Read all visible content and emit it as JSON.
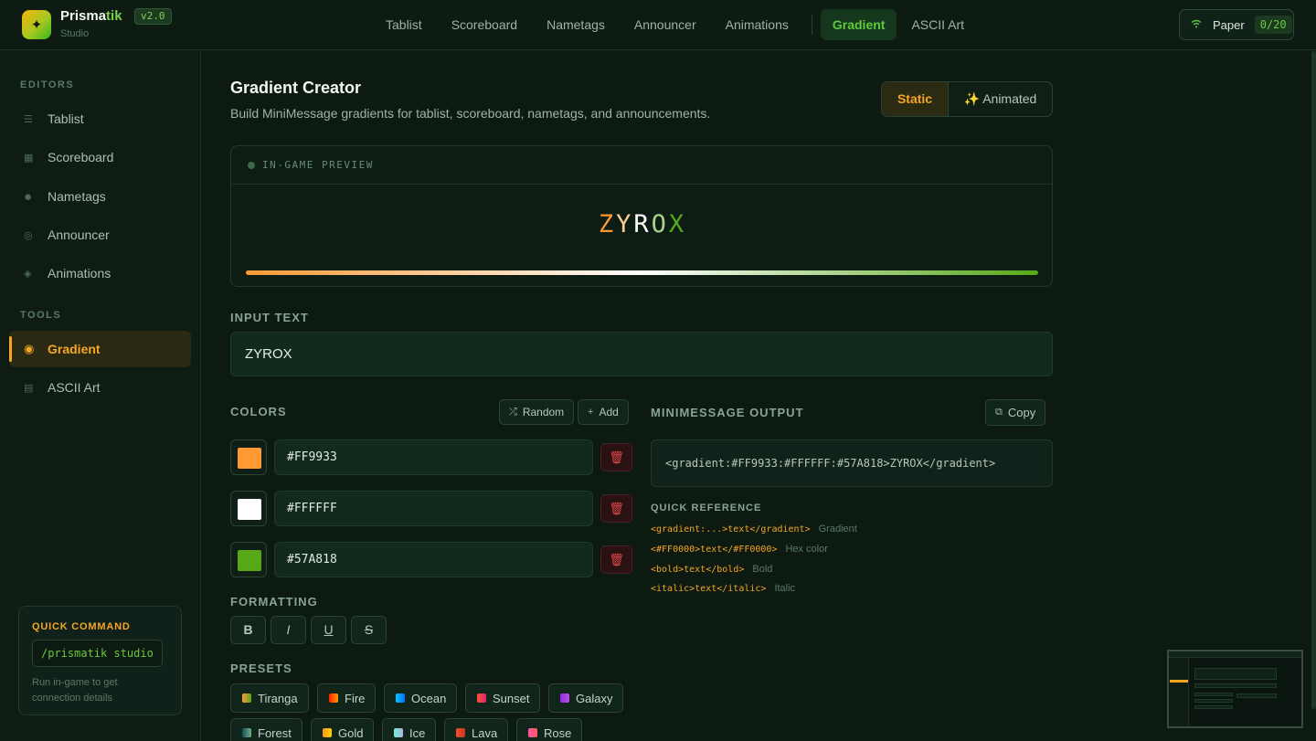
{
  "brand": {
    "name_a": "Prisma",
    "name_b": "tik",
    "version": "v2.0",
    "subtitle": "Studio",
    "logo_icon": "sparkle-icon"
  },
  "nav": {
    "items": [
      "Tablist",
      "Scoreboard",
      "Nametags",
      "Announcer",
      "Animations",
      "Gradient",
      "ASCII Art"
    ],
    "active": "Gradient"
  },
  "server": {
    "icon": "wifi-icon",
    "name": "Paper",
    "count": "0/20"
  },
  "sidebar": {
    "editors_label": "EDITORS",
    "editors": [
      {
        "label": "Tablist",
        "icon": "list-icon"
      },
      {
        "label": "Scoreboard",
        "icon": "grid-icon"
      },
      {
        "label": "Nametags",
        "icon": "tag-icon"
      },
      {
        "label": "Announcer",
        "icon": "megaphone-icon"
      },
      {
        "label": "Animations",
        "icon": "diamond-icon"
      }
    ],
    "tools_label": "TOOLS",
    "tools": [
      {
        "label": "Gradient",
        "icon": "target-icon"
      },
      {
        "label": "ASCII Art",
        "icon": "grid-icon"
      }
    ],
    "quick": {
      "title": "QUICK COMMAND",
      "command": "/prismatik studio",
      "description": "Run in-game to get connection details"
    }
  },
  "main": {
    "title": "Gradient Creator",
    "description": "Build MiniMessage gradients for tablist, scoreboard, nametags, and announcements.",
    "modes": {
      "static": "Static",
      "animated": "✨ Animated",
      "active": "Static"
    },
    "preview": {
      "label": "IN-GAME PREVIEW",
      "text": "ZYROX",
      "letter_colors": [
        "#FF9933",
        "#FFCC99",
        "#FFFFFF",
        "#ABD48C",
        "#57A818"
      ]
    },
    "input": {
      "label": "INPUT TEXT",
      "value": "ZYROX"
    },
    "colors": {
      "label": "COLORS",
      "random_label": "Random",
      "add_label": "Add",
      "list": [
        "#FF9933",
        "#FFFFFF",
        "#57A818"
      ]
    },
    "formatting": {
      "label": "FORMATTING",
      "buttons": [
        "B",
        "I",
        "U",
        "S"
      ]
    },
    "presets": {
      "label": "PRESETS",
      "items": [
        {
          "name": "Tiranga",
          "c1": "#FF9933",
          "c2": "#57A818"
        },
        {
          "name": "Fire",
          "c1": "#FF2200",
          "c2": "#FF9900"
        },
        {
          "name": "Ocean",
          "c1": "#00C6FF",
          "c2": "#0072FF"
        },
        {
          "name": "Sunset",
          "c1": "#FF512F",
          "c2": "#DD2476"
        },
        {
          "name": "Galaxy",
          "c1": "#8E2DE2",
          "c2": "#C04BEA"
        },
        {
          "name": "Forest",
          "c1": "#134E5E",
          "c2": "#71B280"
        },
        {
          "name": "Gold",
          "c1": "#F7971E",
          "c2": "#FFD200"
        },
        {
          "name": "Ice",
          "c1": "#74EBD5",
          "c2": "#ACB6E5"
        },
        {
          "name": "Lava",
          "c1": "#FF4B1F",
          "c2": "#C0392B"
        },
        {
          "name": "Rose",
          "c1": "#F857A6",
          "c2": "#FF5858"
        }
      ]
    },
    "output": {
      "label": "MINIMESSAGE OUTPUT",
      "copy_label": "Copy",
      "value": "<gradient:#FF9933:#FFFFFF:#57A818>ZYROX</gradient>"
    },
    "reference": {
      "label": "QUICK REFERENCE",
      "rows": [
        {
          "code": "<gradient:...>text</gradient>",
          "desc": "Gradient"
        },
        {
          "code": "<#FF0000>text</#FF0000>",
          "desc": "Hex color"
        },
        {
          "code": "<bold>text</bold>",
          "desc": "Bold"
        },
        {
          "code": "<italic>text</italic>",
          "desc": "Italic"
        }
      ]
    }
  },
  "colors": {
    "accent": "#F5A623",
    "brand_green": "#5FCB3D",
    "background": "#0C1A12",
    "danger": "#E04A4A"
  }
}
